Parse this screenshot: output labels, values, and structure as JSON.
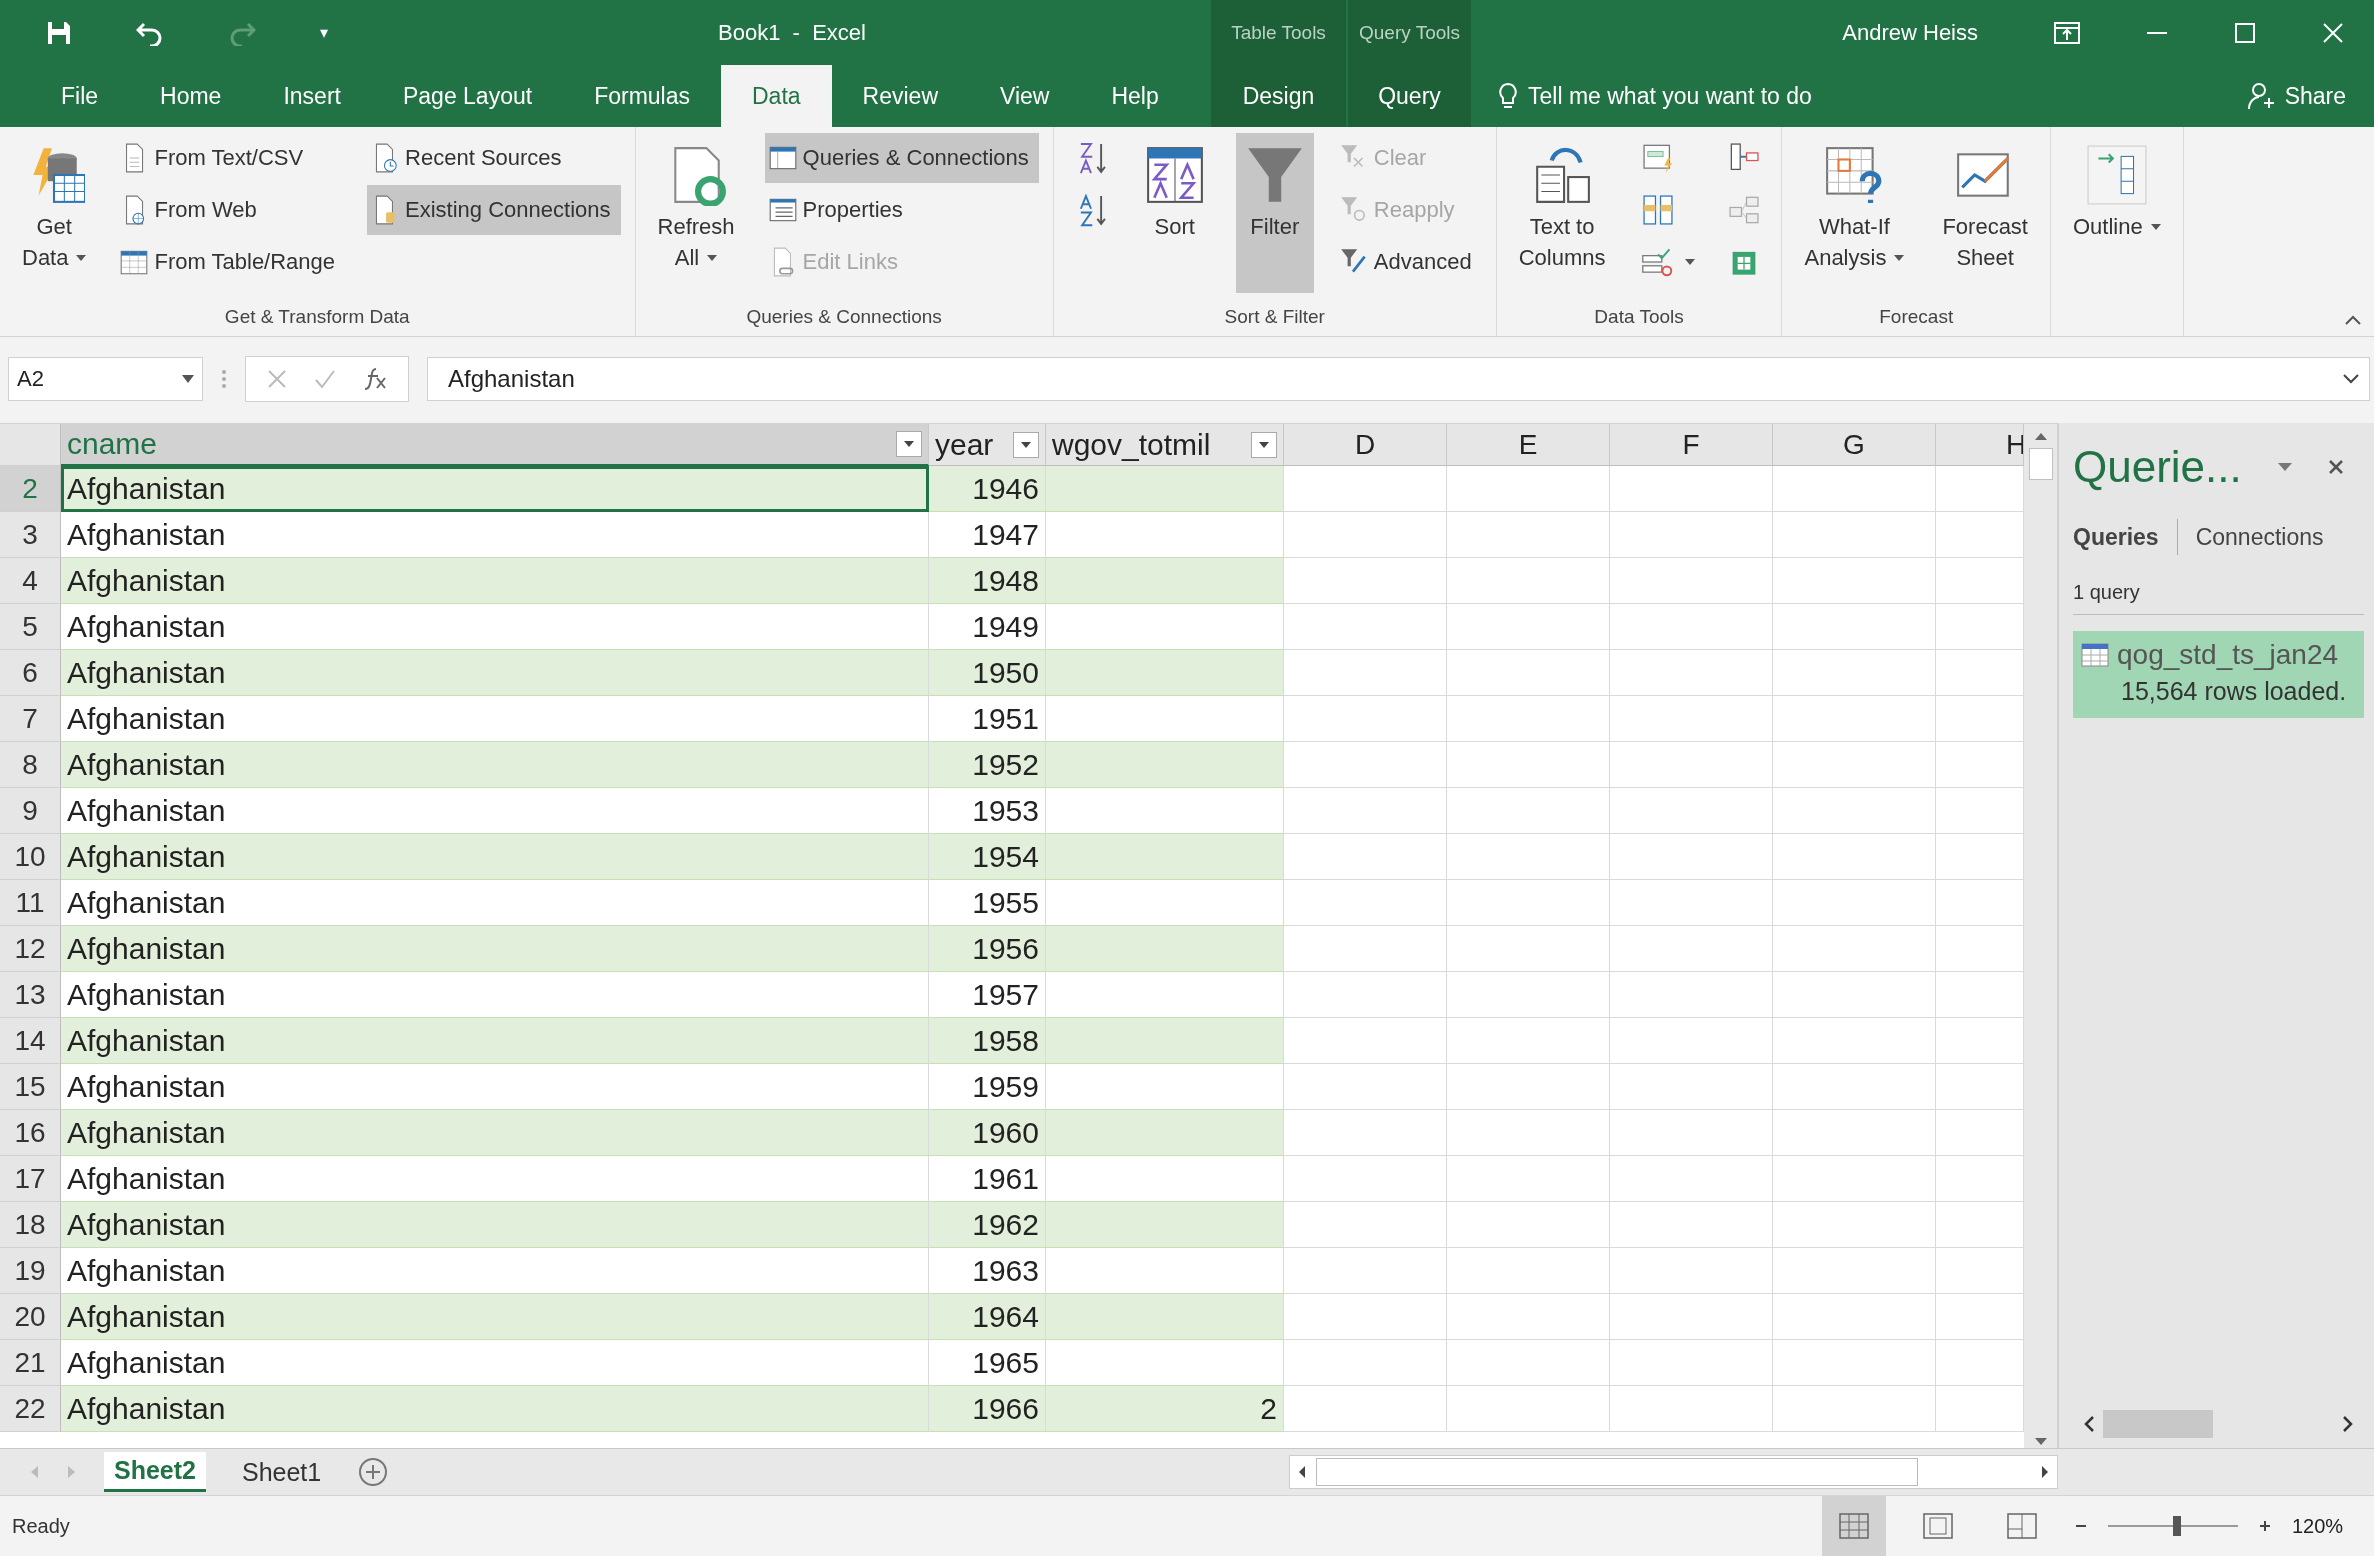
{
  "quick_access": {
    "redo_disabled": true,
    "customize": "▾"
  },
  "window": {
    "title": "Book1  -  Excel",
    "user": "Andrew Heiss"
  },
  "context_tabs": [
    {
      "group": "Table Tools",
      "tab": "Design"
    },
    {
      "group": "Query Tools",
      "tab": "Query"
    }
  ],
  "tabs": [
    {
      "label": "File",
      "selected": false
    },
    {
      "label": "Home",
      "selected": false
    },
    {
      "label": "Insert",
      "selected": false
    },
    {
      "label": "Page Layout",
      "selected": false
    },
    {
      "label": "Formulas",
      "selected": false
    },
    {
      "label": "Data",
      "selected": true
    },
    {
      "label": "Review",
      "selected": false
    },
    {
      "label": "View",
      "selected": false
    },
    {
      "label": "Help",
      "selected": false
    }
  ],
  "tell_me": {
    "placeholder": "Tell me what you want to do"
  },
  "share": "Share",
  "ribbon": {
    "groups": [
      {
        "label": "Get & Transform Data",
        "columns": [
          [
            {
              "kind": "large",
              "lines": [
                "Get",
                "Data"
              ],
              "has_menu": true,
              "pressed": false,
              "disabled": false
            }
          ],
          [
            {
              "kind": "small",
              "label": "From Text/CSV",
              "pressed": false,
              "disabled": false
            },
            {
              "kind": "small",
              "label": "From Web",
              "pressed": false,
              "disabled": false
            },
            {
              "kind": "small",
              "label": "From Table/Range",
              "pressed": false,
              "disabled": false
            }
          ],
          [
            {
              "kind": "small",
              "label": "Recent Sources",
              "pressed": false,
              "disabled": false
            },
            {
              "kind": "small",
              "label": "Existing Connections",
              "pressed": true,
              "disabled": false
            }
          ]
        ]
      },
      {
        "label": "Queries & Connections",
        "columns": [
          [
            {
              "kind": "large",
              "lines": [
                "Refresh",
                "All"
              ],
              "has_menu": true,
              "pressed": false,
              "disabled": false
            }
          ],
          [
            {
              "kind": "small",
              "label": "Queries & Connections",
              "pressed": true,
              "disabled": false
            },
            {
              "kind": "small",
              "label": "Properties",
              "pressed": false,
              "disabled": false
            },
            {
              "kind": "small",
              "label": "Edit Links",
              "pressed": false,
              "disabled": true
            }
          ]
        ]
      },
      {
        "label": "Sort & Filter",
        "columns": [
          [
            {
              "kind": "icon",
              "pressed": false
            },
            {
              "kind": "icon",
              "pressed": false
            }
          ],
          [
            {
              "kind": "large",
              "lines": [
                "Sort"
              ],
              "has_menu": false,
              "pressed": false,
              "disabled": false
            }
          ],
          [
            {
              "kind": "large",
              "lines": [
                "Filter"
              ],
              "has_menu": false,
              "pressed": true,
              "disabled": false
            }
          ],
          [
            {
              "kind": "small",
              "label": "Clear",
              "pressed": false,
              "disabled": true
            },
            {
              "kind": "small",
              "label": "Reapply",
              "pressed": false,
              "disabled": true
            },
            {
              "kind": "small",
              "label": "Advanced",
              "pressed": false,
              "disabled": false
            }
          ]
        ]
      },
      {
        "label": "Data Tools",
        "columns": [
          [
            {
              "kind": "large",
              "lines": [
                "Text to",
                "Columns"
              ],
              "has_menu": false,
              "pressed": false,
              "disabled": false
            }
          ],
          [
            {
              "kind": "icon",
              "pressed": false
            },
            {
              "kind": "icon",
              "pressed": false
            },
            {
              "kind": "icon",
              "has_menu": true,
              "pressed": false
            }
          ],
          [
            {
              "kind": "icon",
              "pressed": false
            },
            {
              "kind": "icon",
              "pressed": false
            },
            {
              "kind": "icon",
              "pressed": false
            }
          ]
        ]
      },
      {
        "label": "Forecast",
        "columns": [
          [
            {
              "kind": "large",
              "lines": [
                "What-If",
                "Analysis"
              ],
              "has_menu": true,
              "pressed": false,
              "disabled": false
            }
          ],
          [
            {
              "kind": "large",
              "lines": [
                "Forecast",
                "Sheet"
              ],
              "has_menu": false,
              "pressed": false,
              "disabled": false
            }
          ]
        ]
      },
      {
        "columns": [
          [
            {
              "kind": "large",
              "lines": [
                "Outline"
              ],
              "has_menu": true,
              "pressed": false,
              "disabled": false
            }
          ]
        ]
      }
    ]
  },
  "formula_bar": {
    "name_box": "A2",
    "value": "Afghanistan"
  },
  "sheet": {
    "columns": [
      {
        "label": "cname",
        "filter": true,
        "selected": true
      },
      {
        "label": "year",
        "filter": true,
        "selected": false
      },
      {
        "label": "wgov_totmil",
        "filter": true,
        "selected": false
      },
      {
        "label": "D",
        "filter": false,
        "selected": false
      },
      {
        "label": "E",
        "filter": false,
        "selected": false
      },
      {
        "label": "F",
        "filter": false,
        "selected": false
      },
      {
        "label": "G",
        "filter": false,
        "selected": false
      },
      {
        "label": "H",
        "filter": false,
        "selected": false
      }
    ],
    "rows": [
      {
        "num": "2",
        "cname": "Afghanistan",
        "year": "1946",
        "selected": true
      },
      {
        "num": "3",
        "cname": "Afghanistan",
        "year": "1947",
        "selected": false
      },
      {
        "num": "4",
        "cname": "Afghanistan",
        "year": "1948",
        "selected": false
      },
      {
        "num": "5",
        "cname": "Afghanistan",
        "year": "1949",
        "selected": false
      },
      {
        "num": "6",
        "cname": "Afghanistan",
        "year": "1950",
        "selected": false
      },
      {
        "num": "7",
        "cname": "Afghanistan",
        "year": "1951",
        "selected": false
      },
      {
        "num": "8",
        "cname": "Afghanistan",
        "year": "1952",
        "selected": false
      },
      {
        "num": "9",
        "cname": "Afghanistan",
        "year": "1953",
        "selected": false
      },
      {
        "num": "10",
        "cname": "Afghanistan",
        "year": "1954",
        "selected": false
      },
      {
        "num": "11",
        "cname": "Afghanistan",
        "year": "1955",
        "selected": false
      },
      {
        "num": "12",
        "cname": "Afghanistan",
        "year": "1956",
        "selected": false
      },
      {
        "num": "13",
        "cname": "Afghanistan",
        "year": "1957",
        "selected": false
      },
      {
        "num": "14",
        "cname": "Afghanistan",
        "year": "1958",
        "selected": false
      },
      {
        "num": "15",
        "cname": "Afghanistan",
        "year": "1959",
        "selected": false
      },
      {
        "num": "16",
        "cname": "Afghanistan",
        "year": "1960",
        "selected": false
      },
      {
        "num": "17",
        "cname": "Afghanistan",
        "year": "1961",
        "selected": false
      },
      {
        "num": "18",
        "cname": "Afghanistan",
        "year": "1962",
        "selected": false
      },
      {
        "num": "19",
        "cname": "Afghanistan",
        "year": "1963",
        "selected": false
      },
      {
        "num": "20",
        "cname": "Afghanistan",
        "year": "1964",
        "selected": false
      },
      {
        "num": "21",
        "cname": "Afghanistan",
        "year": "1965",
        "selected": false
      },
      {
        "num": "22",
        "cname": "Afghanistan",
        "year": "1966",
        "wgov_totmil": "2",
        "selected": false
      }
    ]
  },
  "sheet_tabs": [
    {
      "label": "Sheet2",
      "selected": true
    },
    {
      "label": "Sheet1",
      "selected": false
    }
  ],
  "queries_pane": {
    "title": "Querie...",
    "tabs": [
      {
        "label": "Queries",
        "selected": true
      },
      {
        "label": "Connections",
        "selected": false
      }
    ],
    "count": "1 query",
    "queries": [
      {
        "name": "qog_std_ts_jan24",
        "status": "15,564 rows loaded.",
        "selected": true
      }
    ]
  },
  "status_bar": {
    "status": "Ready",
    "zoom": "120%",
    "zoom_level": {
      "level": 0.53
    }
  }
}
